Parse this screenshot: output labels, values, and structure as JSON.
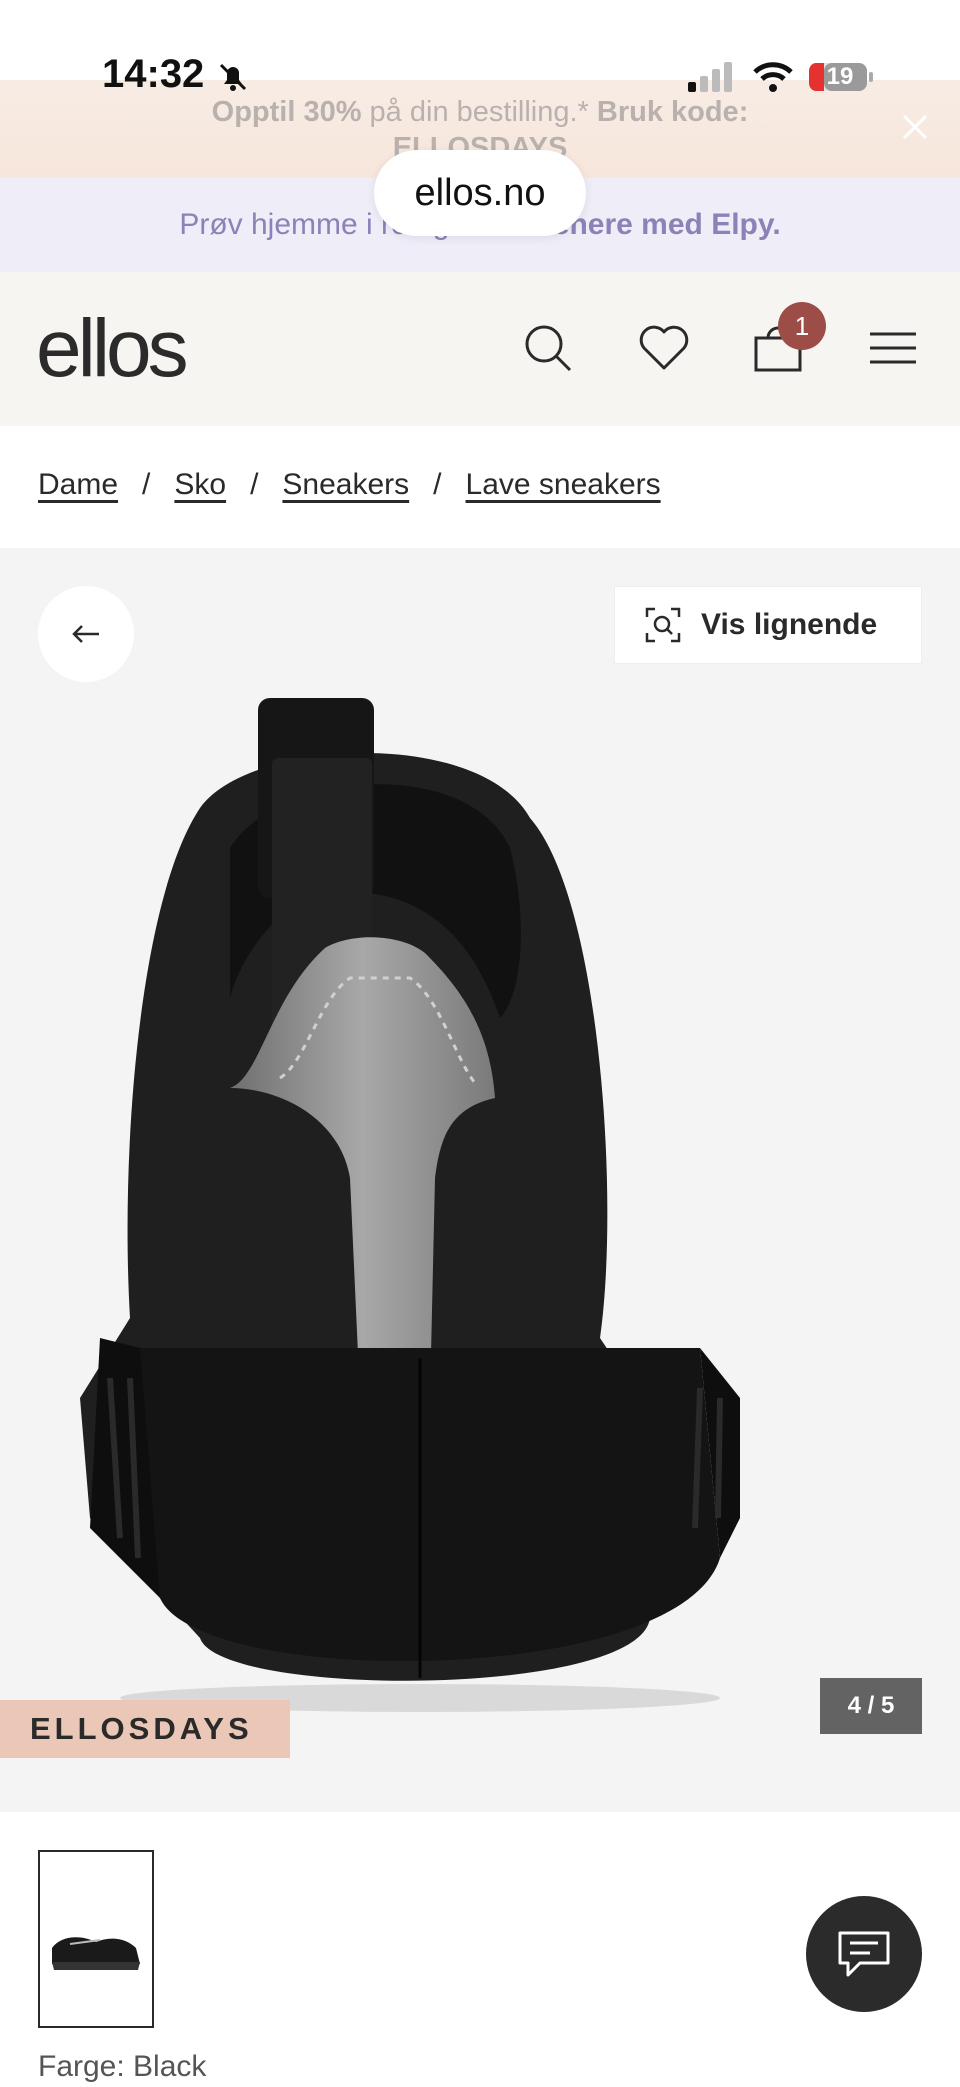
{
  "status": {
    "time": "14:32",
    "battery": "19"
  },
  "promo": {
    "highlight": "Opptil 30%",
    "text": " på din bestilling.* ",
    "code_label": "Bruk kode:",
    "code": "ELLOSDAYS"
  },
  "elpy": {
    "prefix": "Prøv hjemme i ro og ",
    "bold": "betal senere med Elpy."
  },
  "browser": {
    "url": "ellos.no"
  },
  "header": {
    "logo": "ellos",
    "cart_count": "1"
  },
  "breadcrumb": [
    {
      "label": "Dame"
    },
    {
      "label": "Sko"
    },
    {
      "label": "Sneakers"
    },
    {
      "label": "Lave sneakers"
    }
  ],
  "gallery": {
    "similar_label": "Vis lignende",
    "promo_tag": "ELLOSDAYS",
    "counter": "4 / 5"
  },
  "product": {
    "color_label": "Farge: Black"
  },
  "colors": {
    "accent": "#9c4d47",
    "promo_tag": "#eac7b6",
    "elpy": "#8d81b8"
  }
}
